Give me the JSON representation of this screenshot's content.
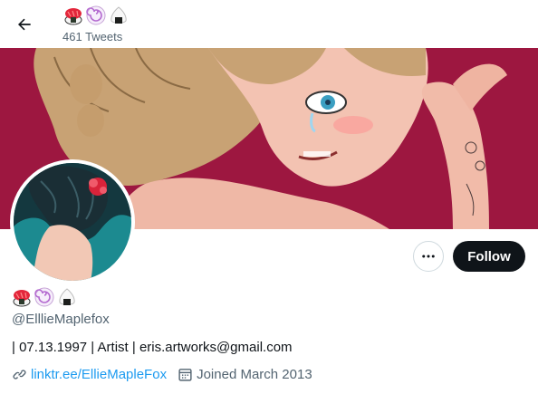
{
  "header": {
    "back_icon": "arrow-left-icon",
    "emoji_names": [
      "sushi-icon",
      "fishcake-icon",
      "onigiri-icon"
    ],
    "tweet_count": "461 Tweets"
  },
  "profile": {
    "emoji_names": [
      "sushi-icon",
      "fishcake-icon",
      "onigiri-icon"
    ],
    "handle": "@ElllieMaplefox",
    "bio": "| 07.13.1997 | Artist | eris.artworks@gmail.com",
    "link": "linktr.ee/EllieMapleFox",
    "joined": "Joined March 2013"
  },
  "actions": {
    "more_icon": "more-icon",
    "follow_label": "Follow"
  },
  "colors": {
    "banner_bg": "#9d1740",
    "follow_bg": "#0f1419",
    "link": "#1d9bf0",
    "muted": "#536471"
  }
}
